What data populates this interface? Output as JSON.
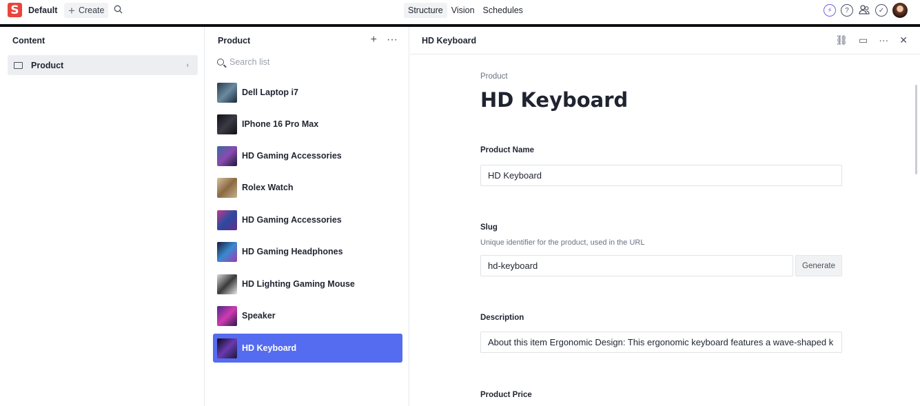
{
  "topbar": {
    "logo_letter": "S",
    "workspace": "Default",
    "create_label": "Create",
    "tabs": [
      {
        "label": "Structure",
        "active": true
      },
      {
        "label": "Vision",
        "active": false
      },
      {
        "label": "Schedules",
        "active": false
      }
    ],
    "icons": [
      "bolt-icon",
      "help-icon",
      "users-icon",
      "tasks-icon",
      "avatar"
    ]
  },
  "content_pane": {
    "title": "Content",
    "items": [
      {
        "label": "Product",
        "icon": "folder-icon"
      }
    ]
  },
  "list_pane": {
    "title": "Product",
    "search_placeholder": "Search list",
    "items": [
      {
        "label": "Dell Laptop i7",
        "thumb": "#3a4a5a"
      },
      {
        "label": "IPhone 16 Pro Max",
        "thumb": "#1e1e24"
      },
      {
        "label": "HD Gaming Accessories",
        "thumb": "#5a3a7a"
      },
      {
        "label": "Rolex Watch",
        "thumb": "#b89a6a"
      },
      {
        "label": "HD Gaming Accessories",
        "thumb": "#7a3a8a"
      },
      {
        "label": "HD Gaming Headphones",
        "thumb": "#2a4a8a"
      },
      {
        "label": "HD Lighting Gaming Mouse",
        "thumb": "#3a3a3a"
      },
      {
        "label": "Speaker",
        "thumb": "#6a2a8a"
      },
      {
        "label": "HD Keyboard",
        "thumb": "#1a1a3a",
        "selected": true
      }
    ]
  },
  "doc_pane": {
    "header_title": "HD Keyboard",
    "breadcrumb": "Product",
    "title": "HD Keyboard",
    "fields": {
      "name_label": "Product Name",
      "name_value": "HD Keyboard",
      "slug_label": "Slug",
      "slug_desc": "Unique identifier for the product, used in the URL",
      "slug_value": "hd-keyboard",
      "generate_label": "Generate",
      "description_label": "Description",
      "description_value": "About this item Ergonomic Design: This ergonomic keyboard features a wave-shaped k",
      "price_label": "Product Price"
    }
  },
  "colors": {
    "brand": "#e8453c",
    "selected": "#556cf0"
  }
}
